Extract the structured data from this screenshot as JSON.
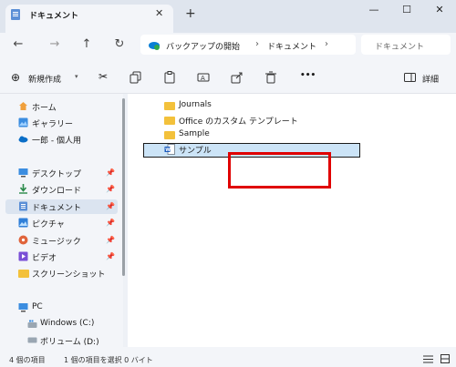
{
  "window": {
    "tab_title": "ドキュメント",
    "new_tab": "+",
    "minimize": "—",
    "maximize": "☐",
    "close": "✕",
    "tab_close": "✕"
  },
  "nav": {
    "back": "←",
    "forward": "→",
    "up": "↑",
    "refresh": "↻",
    "breadcrumb": [
      "バックアップの開始",
      "ドキュメント"
    ],
    "sep": "›",
    "search_placeholder": "ドキュメント"
  },
  "toolbar": {
    "new_label": "新規作成",
    "more": "•••",
    "details_label": "詳細"
  },
  "sidebar": {
    "items": [
      {
        "label": "ホーム",
        "icon": "home-icon"
      },
      {
        "label": "ギャラリー",
        "icon": "gallery-icon"
      },
      {
        "label": "一郎 - 個人用",
        "icon": "cloud-icon"
      },
      {
        "label": "デスクトップ",
        "icon": "desktop-icon",
        "pinned": true
      },
      {
        "label": "ダウンロード",
        "icon": "download-icon",
        "pinned": true
      },
      {
        "label": "ドキュメント",
        "icon": "documents-icon",
        "pinned": true,
        "selected": true
      },
      {
        "label": "ピクチャ",
        "icon": "pictures-icon",
        "pinned": true
      },
      {
        "label": "ミュージック",
        "icon": "music-icon",
        "pinned": true
      },
      {
        "label": "ビデオ",
        "icon": "video-icon",
        "pinned": true
      },
      {
        "label": "スクリーンショット",
        "icon": "screenshot-folder-icon"
      },
      {
        "label": "PC",
        "icon": "pc-icon"
      },
      {
        "label": "Windows (C:)",
        "icon": "drive-icon"
      },
      {
        "label": "ボリューム (D:)",
        "icon": "drive-icon"
      }
    ]
  },
  "files": [
    {
      "name": "Journals",
      "type": "folder"
    },
    {
      "name": "Office のカスタム テンプレート",
      "type": "folder"
    },
    {
      "name": "Sample",
      "type": "folder"
    },
    {
      "name": "サンプル",
      "type": "word-doc",
      "selected": true
    }
  ],
  "status": {
    "count": "4 個の項目",
    "selection": "1 個の項目を選択 0 バイト"
  },
  "colors": {
    "accent": "#0067c0",
    "folder": "#f3c13b",
    "highlight_box": "#e00000",
    "selection": "#cce4f7"
  }
}
